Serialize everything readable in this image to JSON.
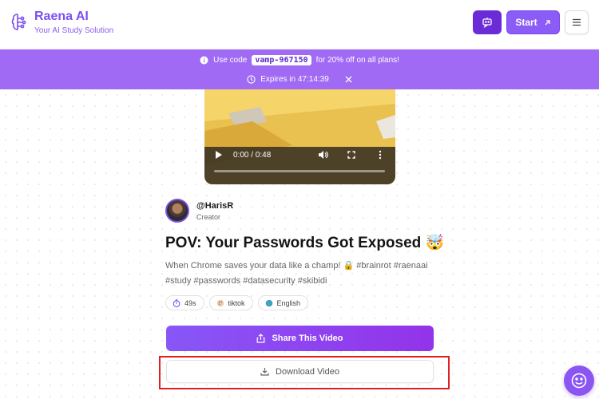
{
  "header": {
    "brand_name": "Raena AI",
    "brand_tagline": "Your AI Study Solution",
    "start_label": "Start",
    "accent_color": "#8b5cf6"
  },
  "banner": {
    "prefix": "Use code",
    "code": "vamp-967150",
    "suffix": "for 20% off on all plans!",
    "expires": "Expires in 47:14:39",
    "background": "#a06af4"
  },
  "video": {
    "time": "0:00 / 0:48",
    "progress": 0.0
  },
  "creator": {
    "name": "@HarisR",
    "role": "Creator"
  },
  "post": {
    "title": "POV: Your Passwords Got Exposed 🤯",
    "description": "When Chrome saves your data like a champ! 🔒 #brainrot #raenaai #study #passwords #datasecurity #skibidi"
  },
  "chips": [
    {
      "icon": "timer-icon",
      "label": "49s"
    },
    {
      "icon": "palette-icon",
      "label": "tiktok"
    },
    {
      "icon": "globe-icon",
      "label": "English"
    }
  ],
  "actions": {
    "share_label": "Share This Video",
    "download_label": "Download Video"
  }
}
